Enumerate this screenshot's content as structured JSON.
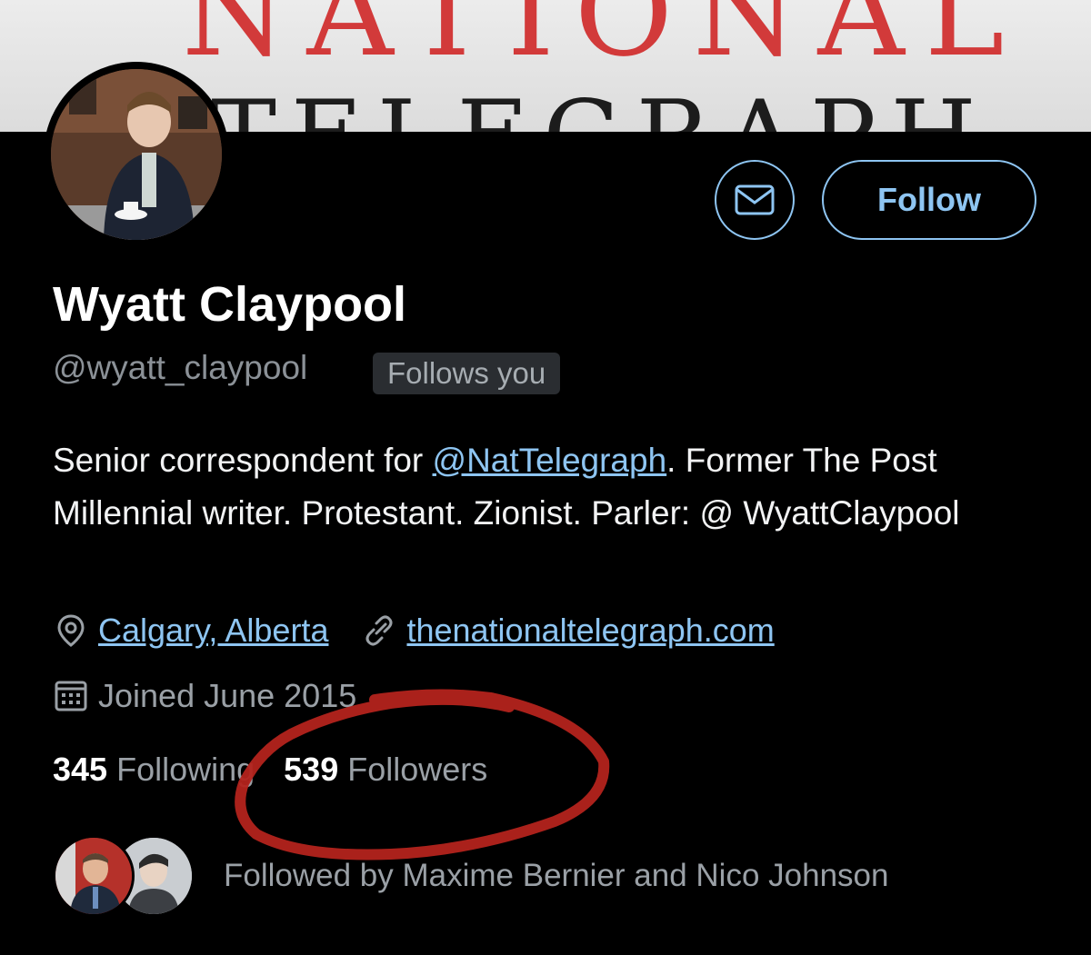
{
  "banner": {
    "line1": "NATIONAL",
    "line2": "TELEGRAPH"
  },
  "actions": {
    "message_icon": "envelope-icon",
    "follow_label": "Follow"
  },
  "profile": {
    "name": "Wyatt Claypool",
    "handle": "@wyatt_claypool",
    "follows_you": "Follows you",
    "bio_prefix": "Senior correspondent for ",
    "bio_mention": "@NatTelegraph",
    "bio_suffix": ". Former The Post Millennial writer. Protestant. Zionist. Parler: @ WyattClaypool",
    "location": "Calgary, Alberta",
    "website": "thenationaltelegraph.com",
    "joined": "Joined June 2015",
    "following_count": "345",
    "following_label": "Following",
    "followers_count": "539",
    "followers_label": "Followers",
    "followed_by": "Followed by Maxime Bernier and Nico Johnson"
  },
  "icons": {
    "location": "map-pin-icon",
    "link": "link-icon",
    "calendar": "calendar-icon"
  },
  "colors": {
    "background": "#000000",
    "accent": "#8ec5f2",
    "annotation": "#b3231c"
  }
}
